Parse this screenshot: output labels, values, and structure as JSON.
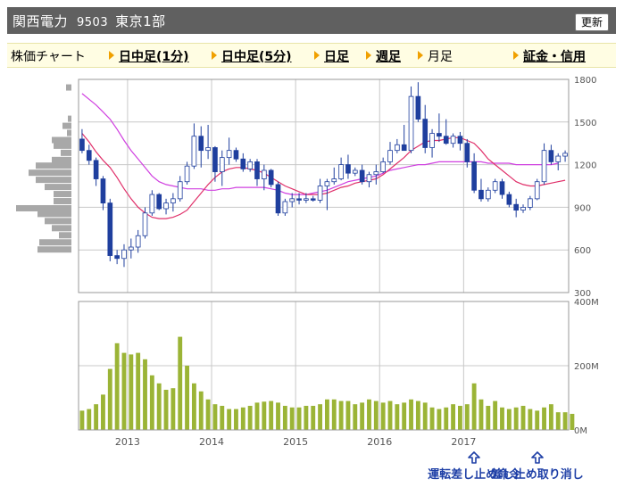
{
  "header": {
    "company": "関西電力",
    "code": "9503",
    "market": "東京1部",
    "refresh_label": "更新"
  },
  "nav": {
    "label": "株価チャート",
    "items": [
      "日中足(1分)",
      "日中足(5分)",
      "日足",
      "週足",
      "月足"
    ],
    "current": "月足",
    "margin_link": "証金・信用"
  },
  "chart_data": {
    "type": "candlestick+bar",
    "price_axis": {
      "ticks": [
        1800,
        1500,
        1200,
        900,
        600,
        300
      ],
      "ylim": [
        300,
        1800
      ]
    },
    "volume_axis": {
      "ticks": [
        "400M",
        "200M",
        "0M"
      ],
      "ylim": [
        0,
        400
      ]
    },
    "x_tick_labels": [
      "2013",
      "2014",
      "2015",
      "2016",
      "2017"
    ],
    "candles": [
      {
        "o": 1380,
        "h": 1450,
        "l": 1280,
        "c": 1300
      },
      {
        "o": 1300,
        "h": 1340,
        "l": 1200,
        "c": 1230
      },
      {
        "o": 1230,
        "h": 1250,
        "l": 1050,
        "c": 1100
      },
      {
        "o": 1100,
        "h": 1120,
        "l": 880,
        "c": 930
      },
      {
        "o": 930,
        "h": 960,
        "l": 520,
        "c": 560
      },
      {
        "o": 560,
        "h": 600,
        "l": 500,
        "c": 540
      },
      {
        "o": 540,
        "h": 640,
        "l": 480,
        "c": 600
      },
      {
        "o": 600,
        "h": 680,
        "l": 540,
        "c": 620
      },
      {
        "o": 620,
        "h": 740,
        "l": 580,
        "c": 700
      },
      {
        "o": 700,
        "h": 900,
        "l": 680,
        "c": 860
      },
      {
        "o": 860,
        "h": 1020,
        "l": 840,
        "c": 990
      },
      {
        "o": 990,
        "h": 1000,
        "l": 880,
        "c": 890
      },
      {
        "o": 890,
        "h": 960,
        "l": 850,
        "c": 930
      },
      {
        "o": 930,
        "h": 1000,
        "l": 870,
        "c": 960
      },
      {
        "o": 960,
        "h": 1120,
        "l": 940,
        "c": 1080
      },
      {
        "o": 1080,
        "h": 1220,
        "l": 1060,
        "c": 1190
      },
      {
        "o": 1190,
        "h": 1490,
        "l": 1170,
        "c": 1400
      },
      {
        "o": 1400,
        "h": 1470,
        "l": 1180,
        "c": 1300
      },
      {
        "o": 1300,
        "h": 1480,
        "l": 1240,
        "c": 1320
      },
      {
        "o": 1320,
        "h": 1330,
        "l": 1080,
        "c": 1150
      },
      {
        "o": 1150,
        "h": 1300,
        "l": 1050,
        "c": 1250
      },
      {
        "o": 1250,
        "h": 1390,
        "l": 1200,
        "c": 1300
      },
      {
        "o": 1300,
        "h": 1320,
        "l": 1220,
        "c": 1240
      },
      {
        "o": 1240,
        "h": 1280,
        "l": 1150,
        "c": 1170
      },
      {
        "o": 1170,
        "h": 1240,
        "l": 1150,
        "c": 1220
      },
      {
        "o": 1220,
        "h": 1240,
        "l": 1050,
        "c": 1100
      },
      {
        "o": 1100,
        "h": 1200,
        "l": 1020,
        "c": 1160
      },
      {
        "o": 1160,
        "h": 1170,
        "l": 1040,
        "c": 1060
      },
      {
        "o": 1060,
        "h": 1080,
        "l": 840,
        "c": 860
      },
      {
        "o": 860,
        "h": 960,
        "l": 840,
        "c": 940
      },
      {
        "o": 940,
        "h": 1000,
        "l": 900,
        "c": 960
      },
      {
        "o": 960,
        "h": 1000,
        "l": 920,
        "c": 950
      },
      {
        "o": 950,
        "h": 1000,
        "l": 930,
        "c": 960
      },
      {
        "o": 960,
        "h": 980,
        "l": 940,
        "c": 950
      },
      {
        "o": 950,
        "h": 1100,
        "l": 930,
        "c": 1050
      },
      {
        "o": 1050,
        "h": 1100,
        "l": 880,
        "c": 1080
      },
      {
        "o": 1080,
        "h": 1180,
        "l": 1060,
        "c": 1100
      },
      {
        "o": 1100,
        "h": 1250,
        "l": 1090,
        "c": 1200
      },
      {
        "o": 1200,
        "h": 1270,
        "l": 1100,
        "c": 1140
      },
      {
        "o": 1140,
        "h": 1180,
        "l": 1120,
        "c": 1160
      },
      {
        "o": 1160,
        "h": 1200,
        "l": 1060,
        "c": 1080
      },
      {
        "o": 1080,
        "h": 1150,
        "l": 1040,
        "c": 1130
      },
      {
        "o": 1130,
        "h": 1200,
        "l": 1060,
        "c": 1150
      },
      {
        "o": 1150,
        "h": 1250,
        "l": 1140,
        "c": 1220
      },
      {
        "o": 1220,
        "h": 1360,
        "l": 1200,
        "c": 1300
      },
      {
        "o": 1300,
        "h": 1380,
        "l": 1280,
        "c": 1340
      },
      {
        "o": 1340,
        "h": 1480,
        "l": 1300,
        "c": 1300
      },
      {
        "o": 1300,
        "h": 1750,
        "l": 1280,
        "c": 1680
      },
      {
        "o": 1680,
        "h": 1780,
        "l": 1500,
        "c": 1520
      },
      {
        "o": 1520,
        "h": 1620,
        "l": 1280,
        "c": 1320
      },
      {
        "o": 1320,
        "h": 1450,
        "l": 1250,
        "c": 1420
      },
      {
        "o": 1420,
        "h": 1560,
        "l": 1360,
        "c": 1400
      },
      {
        "o": 1400,
        "h": 1520,
        "l": 1340,
        "c": 1350
      },
      {
        "o": 1350,
        "h": 1420,
        "l": 1320,
        "c": 1400
      },
      {
        "o": 1400,
        "h": 1430,
        "l": 1300,
        "c": 1350
      },
      {
        "o": 1350,
        "h": 1380,
        "l": 1180,
        "c": 1220
      },
      {
        "o": 1220,
        "h": 1280,
        "l": 1000,
        "c": 1020
      },
      {
        "o": 1020,
        "h": 1100,
        "l": 940,
        "c": 960
      },
      {
        "o": 960,
        "h": 1040,
        "l": 940,
        "c": 1020
      },
      {
        "o": 1020,
        "h": 1100,
        "l": 1000,
        "c": 1080
      },
      {
        "o": 1080,
        "h": 1100,
        "l": 960,
        "c": 990
      },
      {
        "o": 990,
        "h": 1010,
        "l": 900,
        "c": 920
      },
      {
        "o": 920,
        "h": 960,
        "l": 830,
        "c": 880
      },
      {
        "o": 880,
        "h": 920,
        "l": 860,
        "c": 900
      },
      {
        "o": 900,
        "h": 980,
        "l": 880,
        "c": 960
      },
      {
        "o": 960,
        "h": 1100,
        "l": 950,
        "c": 1080
      },
      {
        "o": 1080,
        "h": 1350,
        "l": 1060,
        "c": 1300
      },
      {
        "o": 1300,
        "h": 1340,
        "l": 1200,
        "c": 1220
      },
      {
        "o": 1220,
        "h": 1280,
        "l": 1160,
        "c": 1260
      },
      {
        "o": 1260,
        "h": 1300,
        "l": 1220,
        "c": 1280
      }
    ],
    "ma_red": [
      1420,
      1360,
      1290,
      1230,
      1180,
      1110,
      1030,
      960,
      900,
      860,
      830,
      820,
      820,
      830,
      850,
      880,
      940,
      1000,
      1060,
      1110,
      1150,
      1170,
      1180,
      1180,
      1170,
      1160,
      1140,
      1110,
      1080,
      1050,
      1030,
      1010,
      990,
      990,
      990,
      1000,
      1020,
      1040,
      1050,
      1070,
      1080,
      1090,
      1100,
      1130,
      1170,
      1210,
      1250,
      1300,
      1330,
      1360,
      1370,
      1370,
      1380,
      1390,
      1390,
      1370,
      1350,
      1300,
      1240,
      1200,
      1160,
      1120,
      1080,
      1060,
      1050,
      1050,
      1060,
      1070,
      1080,
      1090
    ],
    "ma_magenta": [
      1700,
      1660,
      1620,
      1570,
      1520,
      1450,
      1370,
      1300,
      1240,
      1180,
      1120,
      1080,
      1060,
      1050,
      1040,
      1030,
      1030,
      1030,
      1020,
      1020,
      1030,
      1030,
      1040,
      1040,
      1040,
      1040,
      1040,
      1030,
      1020,
      1000,
      990,
      990,
      990,
      1000,
      1010,
      1020,
      1040,
      1060,
      1080,
      1090,
      1100,
      1110,
      1120,
      1140,
      1160,
      1170,
      1180,
      1190,
      1200,
      1200,
      1210,
      1220,
      1220,
      1220,
      1220,
      1220,
      1220,
      1220,
      1210,
      1210,
      1210,
      1210,
      1200,
      1200,
      1200,
      1200,
      1200,
      1200,
      1210
    ],
    "volume": [
      60,
      65,
      80,
      110,
      190,
      270,
      240,
      235,
      240,
      220,
      170,
      145,
      125,
      130,
      290,
      200,
      145,
      120,
      95,
      80,
      75,
      65,
      65,
      70,
      75,
      85,
      88,
      90,
      85,
      75,
      70,
      70,
      75,
      75,
      80,
      95,
      95,
      90,
      90,
      80,
      85,
      95,
      90,
      85,
      90,
      80,
      85,
      95,
      90,
      85,
      70,
      65,
      70,
      80,
      75,
      80,
      145,
      95,
      75,
      90,
      70,
      65,
      70,
      75,
      65,
      60,
      70,
      80,
      55,
      55,
      50
    ],
    "volume_profile_rows": [
      1740,
      1520,
      1470,
      1420,
      1370,
      1330,
      1280,
      1230,
      1190,
      1140,
      1090,
      1040,
      990,
      940,
      890,
      850,
      800,
      750,
      700,
      650,
      600
    ],
    "volume_profile_lengths": [
      6,
      4,
      10,
      5,
      22,
      20,
      12,
      22,
      40,
      48,
      40,
      30,
      20,
      20,
      62,
      38,
      30,
      22,
      14,
      36,
      38
    ],
    "annotations": [
      {
        "text": "運転差し止め命令",
        "index": 56
      },
      {
        "text": "差し止め取り消し",
        "index": 65
      }
    ],
    "colors": {
      "up_candle": "#ffffff",
      "down_candle": "#1f3f9e",
      "candle_border": "#1f3f9e",
      "ma_red": "#e0306a",
      "ma_magenta": "#d040e0",
      "volume_bar": "#9bb436",
      "profile_bar": "#a8a8a8",
      "grid": "#c8c8c8",
      "annotation": "#1e3fa6"
    }
  }
}
